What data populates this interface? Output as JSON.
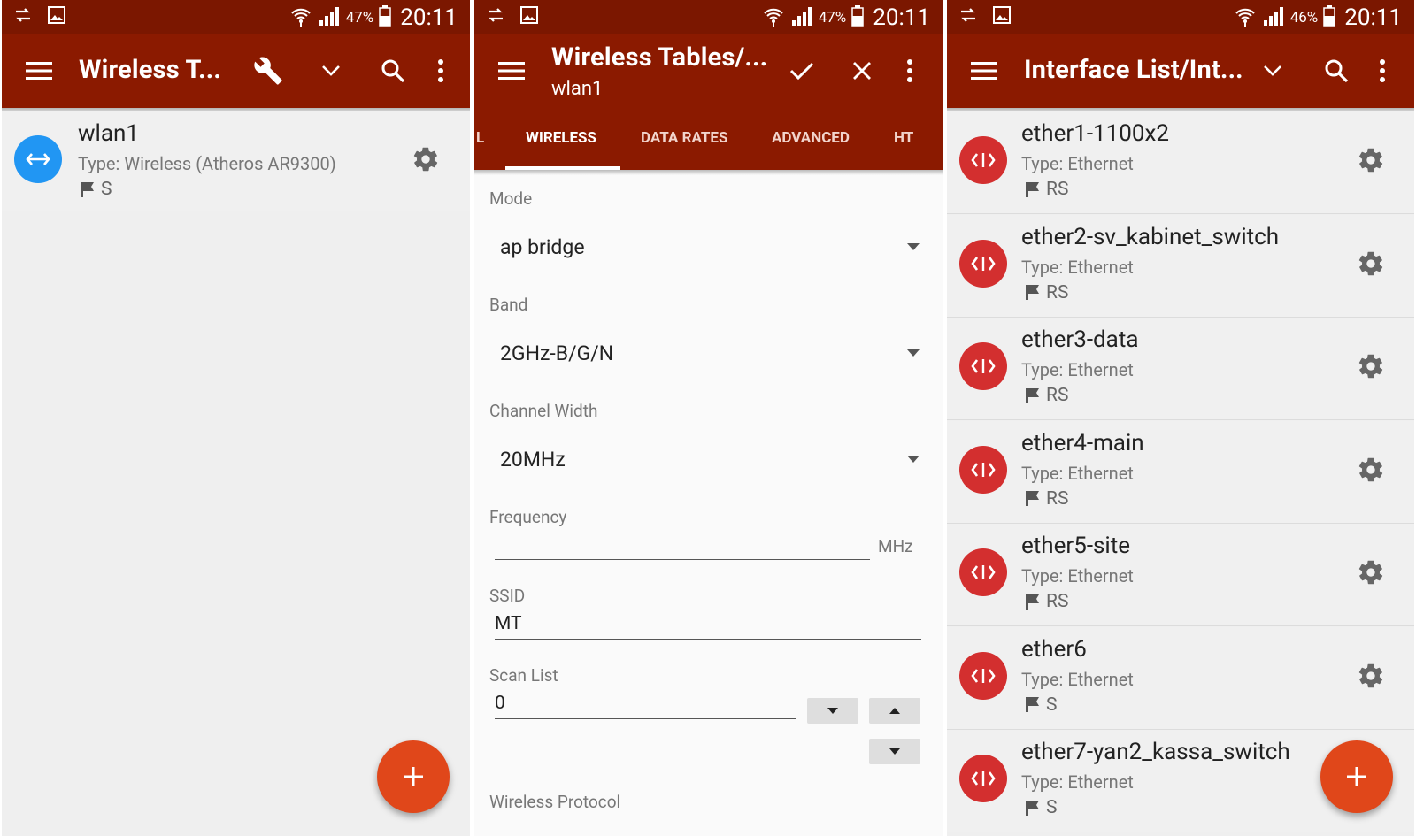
{
  "colors": {
    "toolbar": "#8b1a00",
    "statusbar": "#7b1700",
    "fab": "#e0471a",
    "wireless_avatar": "#2196f3",
    "ethernet_avatar": "#d32f2f"
  },
  "panel1": {
    "status": {
      "battery": "47%",
      "time": "20:11"
    },
    "title": "Wireless T...",
    "items": [
      {
        "name": "wlan1",
        "type": "Type: Wireless (Atheros AR9300)",
        "flags": "S",
        "icon": "wireless-arrows-icon"
      }
    ],
    "fab_label": "+"
  },
  "panel2": {
    "status": {
      "battery": "47%",
      "time": "20:11"
    },
    "title": "Wireless Tables/...",
    "subtitle": "wlan1",
    "tabs": [
      "L",
      "WIRELESS",
      "DATA RATES",
      "ADVANCED",
      "HT"
    ],
    "active_tab": "WIRELESS",
    "fields": {
      "mode": {
        "label": "Mode",
        "value": "ap bridge"
      },
      "band": {
        "label": "Band",
        "value": "2GHz-B/G/N"
      },
      "channel_width": {
        "label": "Channel Width",
        "value": "20MHz"
      },
      "frequency": {
        "label": "Frequency",
        "value": "",
        "unit": "MHz"
      },
      "ssid": {
        "label": "SSID",
        "value": "MT"
      },
      "scan_list": {
        "label": "Scan List",
        "value": "0"
      },
      "wireless_protocol": {
        "label": "Wireless Protocol"
      }
    }
  },
  "panel3": {
    "status": {
      "battery": "46%",
      "time": "20:11"
    },
    "title": "Interface List/Int...",
    "items": [
      {
        "name": "ether1-1100x2",
        "type": "Type: Ethernet",
        "flags": "RS"
      },
      {
        "name": "ether2-sv_kabinet_switch",
        "type": "Type: Ethernet",
        "flags": "RS"
      },
      {
        "name": "ether3-data",
        "type": "Type: Ethernet",
        "flags": "RS"
      },
      {
        "name": "ether4-main",
        "type": "Type: Ethernet",
        "flags": "RS"
      },
      {
        "name": "ether5-site",
        "type": "Type: Ethernet",
        "flags": "RS"
      },
      {
        "name": "ether6",
        "type": "Type: Ethernet",
        "flags": "S"
      },
      {
        "name": "ether7-yan2_kassa_switch",
        "type": "Type: Ethernet",
        "flags": "S"
      }
    ],
    "fab_label": "+"
  }
}
